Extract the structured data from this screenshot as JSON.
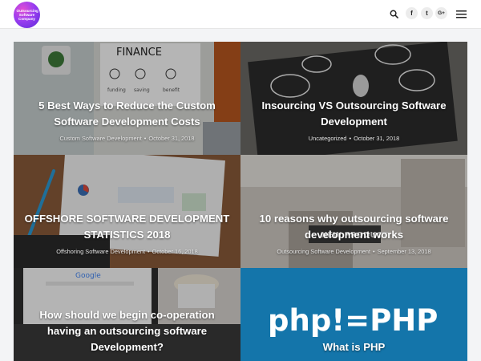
{
  "header": {
    "logo_text": "Outsourcing Software Company",
    "search_icon": "search-icon",
    "social": [
      {
        "name": "facebook",
        "glyph": "f"
      },
      {
        "name": "twitter",
        "glyph": "t"
      },
      {
        "name": "google-plus",
        "glyph": "G+"
      }
    ],
    "menu_icon": "hamburger-menu-icon"
  },
  "posts": [
    {
      "title": "5 Best Ways to Reduce the Custom Software Development Costs",
      "category": "Custom Software Development",
      "separator": "•",
      "date": "October 31, 2018",
      "image_text": [
        "FINANCE",
        "funding",
        "saving",
        "benefit"
      ]
    },
    {
      "title": "Insourcing VS Outsourcing Software Development",
      "category": "Uncategorized",
      "separator": "•",
      "date": "October 31, 2018"
    },
    {
      "title": "OFFSHORE SOFTWARE DEVELOPMENT STATISTICS 2018",
      "category": "Offshoring Software Development",
      "separator": "•",
      "date": "October 16, 2018"
    },
    {
      "title": "10 reasons why outsourcing software development works",
      "category": "Outsourcing Software Development",
      "separator": "•",
      "date": "September 13, 2018",
      "image_text": [
        "NEW PRODUCT"
      ]
    },
    {
      "title": "How should we begin co-operation having an outsourcing software Development?",
      "category": "",
      "separator": "",
      "date": "",
      "image_text": [
        "Google"
      ]
    },
    {
      "title": "What is PHP",
      "category": "",
      "separator": "",
      "date": "",
      "image_text": [
        "php!=PHP"
      ]
    }
  ]
}
